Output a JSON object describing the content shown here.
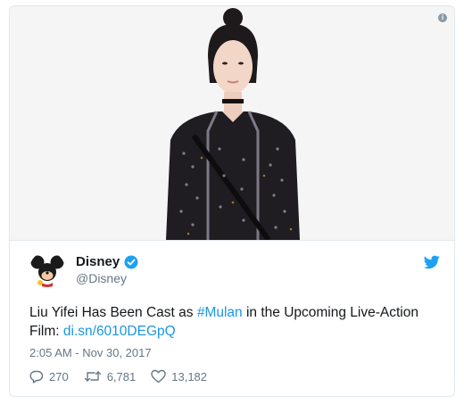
{
  "tweet": {
    "author_name": "Disney",
    "author_handle": "@Disney",
    "text_before": "Liu Yifei Has Been Cast as ",
    "hashtag": "#Mulan",
    "text_after": " in the Upcoming Live-Action Film: ",
    "link": "di.sn/6010DEGpQ",
    "timestamp": "2:05 AM - Nov 30, 2017",
    "reply_count": "270",
    "retweet_count": "6,781",
    "like_count": "13,182"
  },
  "icons": {
    "info": "info-icon",
    "verified": "verified-badge-icon",
    "twitter": "twitter-bird-icon",
    "reply": "reply-icon",
    "retweet": "retweet-icon",
    "like": "heart-icon"
  },
  "colors": {
    "link": "#1b95e0",
    "muted": "#657786",
    "border": "#e1e8ed",
    "verified": "#1da1f2"
  }
}
